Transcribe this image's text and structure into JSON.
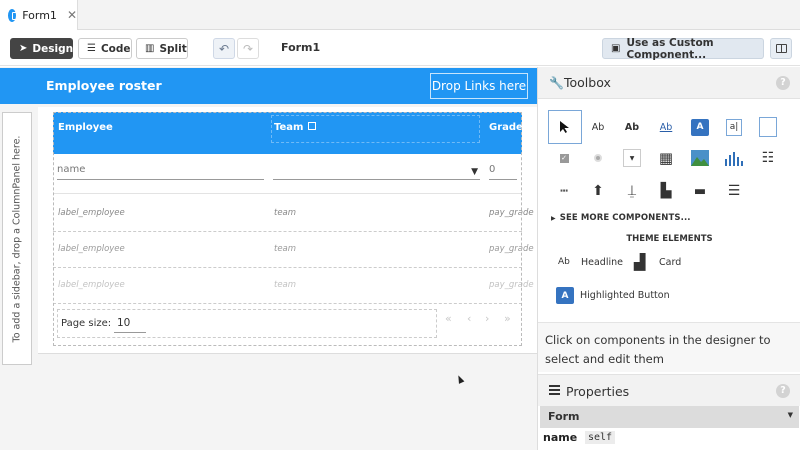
{
  "tab": {
    "title": "Form1",
    "close": "✕"
  },
  "toolbar": {
    "design_label": "Design",
    "code_label": "Code",
    "split_label": "Split",
    "form_title": "Form1",
    "custom_component_label": "Use as Custom Component..."
  },
  "app": {
    "title": "Employee roster",
    "drop_links": "Drop Links here",
    "sidebar_hint": "To add a sidebar, drop a ColumnPanel here."
  },
  "grid": {
    "columns": [
      "Employee",
      "Team",
      "Grade"
    ],
    "filter": {
      "name_placeholder": "name",
      "grade_value": "0"
    },
    "rows": [
      {
        "employee": "label_employee",
        "team": "team",
        "grade": "pay_grade"
      },
      {
        "employee": "label_employee",
        "team": "team",
        "grade": "pay_grade"
      },
      {
        "employee": "label_employee",
        "team": "team",
        "grade": "pay_grade"
      }
    ],
    "page_size_label": "Page size:",
    "page_size_value": "10"
  },
  "toolbox": {
    "title": "Toolbox",
    "see_more": "SEE MORE COMPONENTS...",
    "theme_elements_title": "THEME ELEMENTS",
    "theme_items": [
      "Headline",
      "Card",
      "Highlighted Button"
    ]
  },
  "hint_text": "Click on components in the designer to select and edit them",
  "properties": {
    "title": "Properties",
    "selected": "Form",
    "name_label": "name",
    "name_value": "self"
  },
  "colors": {
    "accent": "#2196f3",
    "toolbar_active": "#444444"
  }
}
